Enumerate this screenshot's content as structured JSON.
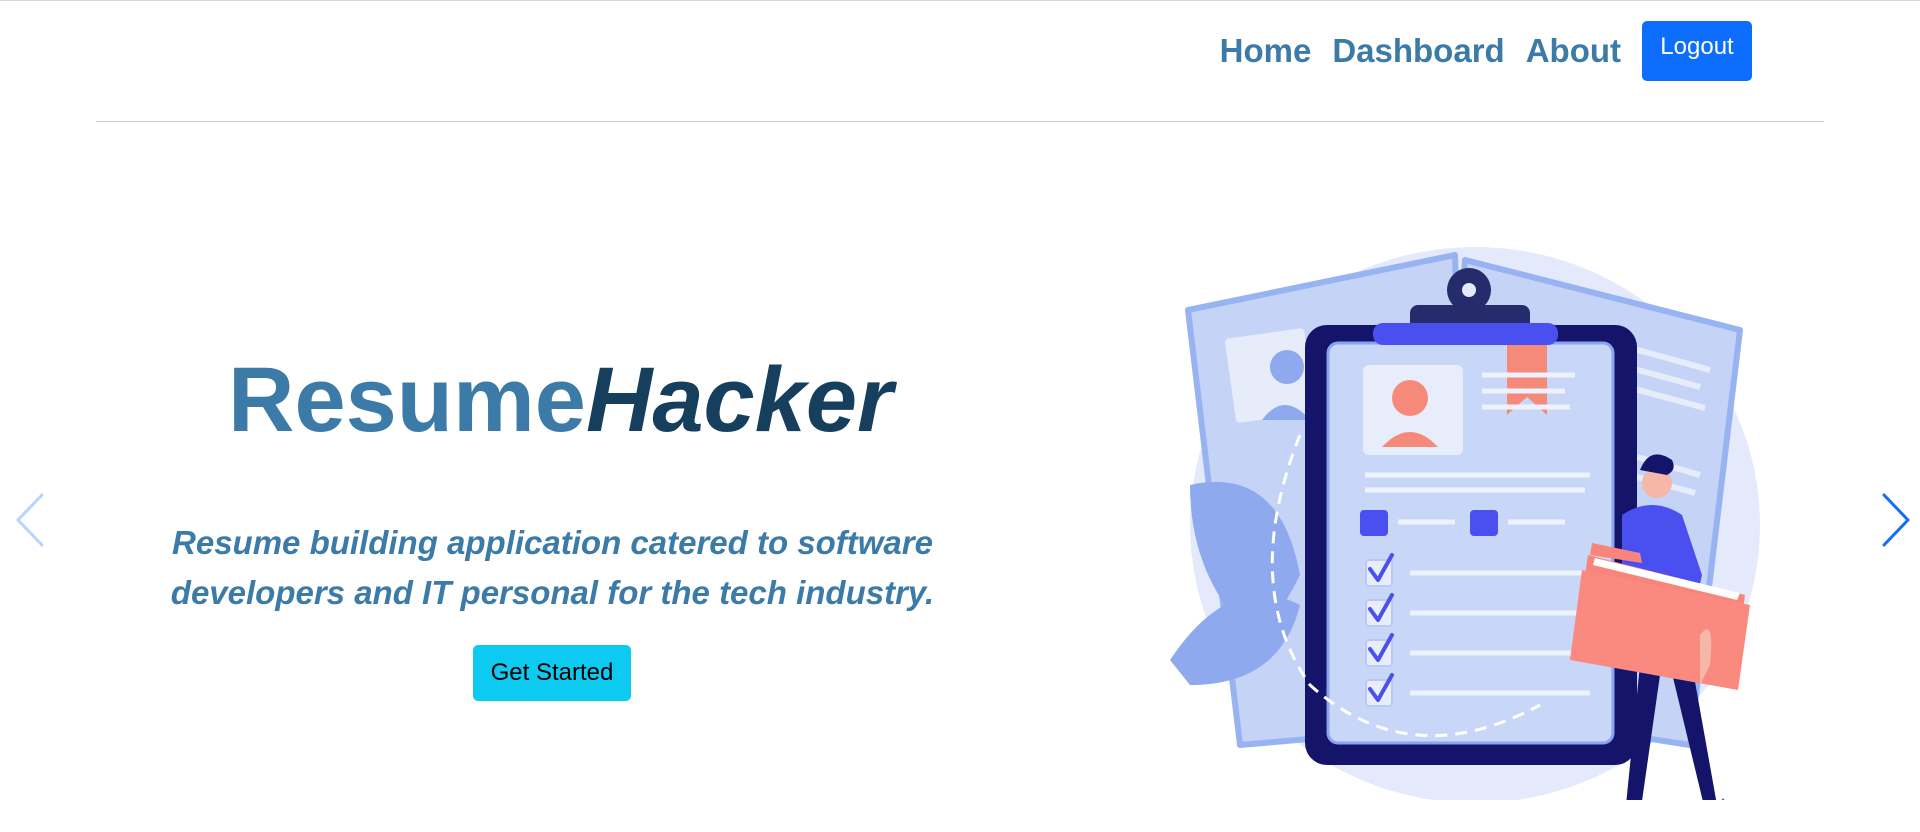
{
  "nav": {
    "links": [
      "Home",
      "Dashboard",
      "About"
    ],
    "logout_label": "Logout"
  },
  "hero": {
    "brand_part1": "Resume",
    "brand_part2": "Hacker",
    "tagline": "Resume building application catered to software developers and IT personal for the tech industry.",
    "cta_label": "Get Started"
  },
  "carousel": {
    "prev_icon": "chevron-left-icon",
    "next_icon": "chevron-right-icon"
  },
  "colors": {
    "accent": "#3c7ba7",
    "brand_dark": "#163f5e",
    "primary_button": "#0d6efd",
    "cta_button": "#0dcaf0"
  },
  "illustration": {
    "icon": "resume-clipboard-illustration"
  }
}
